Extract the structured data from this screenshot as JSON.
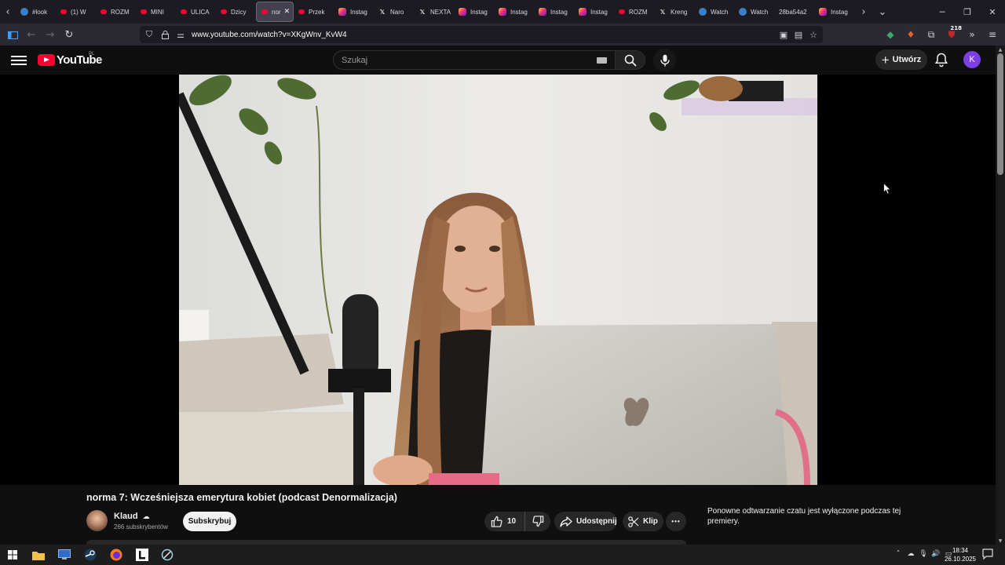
{
  "browser": {
    "tabs": [
      {
        "label": "#look",
        "icon": "generic-icon"
      },
      {
        "label": "(1) W",
        "icon": "youtube-icon"
      },
      {
        "label": "ROZM",
        "icon": "youtube-icon"
      },
      {
        "label": "MINI",
        "icon": "youtube-icon"
      },
      {
        "label": "ULICA",
        "icon": "youtube-icon"
      },
      {
        "label": "Dzicy",
        "icon": "youtube-icon"
      },
      {
        "label": "nor",
        "icon": "youtube-icon",
        "active": true
      },
      {
        "label": "Przek",
        "icon": "youtube-icon"
      },
      {
        "label": "Instag",
        "icon": "instagram-icon"
      },
      {
        "label": "Naro",
        "icon": "x-icon"
      },
      {
        "label": "NEXTA",
        "icon": "x-icon"
      },
      {
        "label": "Instag",
        "icon": "instagram-icon"
      },
      {
        "label": "Instag",
        "icon": "instagram-icon"
      },
      {
        "label": "Instag",
        "icon": "instagram-icon"
      },
      {
        "label": "Instag",
        "icon": "instagram-icon"
      },
      {
        "label": "ROZM",
        "icon": "youtube-icon"
      },
      {
        "label": "Kreng",
        "icon": "x-icon"
      },
      {
        "label": "Watch",
        "icon": "generic-icon"
      },
      {
        "label": "Watch",
        "icon": "generic-icon"
      },
      {
        "label": "28ba54a2",
        "icon": "none"
      },
      {
        "label": "Instag",
        "icon": "instagram-icon"
      }
    ],
    "url": "www.youtube.com/watch?v=XKgWnv_KvW4",
    "extension_badge": "218"
  },
  "youtube": {
    "logo_text": "YouTube",
    "country_code": "PL",
    "search_placeholder": "Szukaj",
    "create_label": "Utwórz",
    "avatar_letter": "K"
  },
  "video": {
    "title": "norma 7: Wcześniejsza emerytura kobiet (podcast Denormalizacja)",
    "channel_name": "Klaud",
    "subscribers": "266 subskrybentów",
    "subscribe_label": "Subskrybuj",
    "likes": "10",
    "share_label": "Udostępnij",
    "clip_label": "Klip",
    "more_label": "•••",
    "chat_note": "Ponowne odtwarzanie czatu jest wyłączone podczas tej premiery."
  },
  "taskbar": {
    "time": "18:34",
    "date": "26.10.2025"
  },
  "colors": {
    "youtube_red": "#ff0033",
    "yt_background": "#0f0f0f",
    "browser_chrome": "#1c1b22",
    "avatar_purple": "#7b3fe4"
  }
}
